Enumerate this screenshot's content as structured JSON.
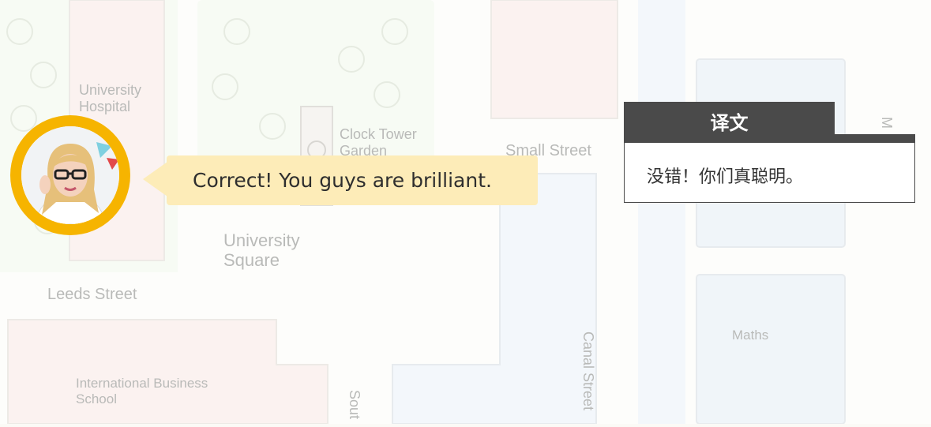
{
  "map": {
    "labels": {
      "hospital_1": "University",
      "hospital_2": "Hospital",
      "clock_tower_1": "Clock Tower",
      "clock_tower_2": "Garden",
      "small_street": "Small Street",
      "university_square_1": "University",
      "university_square_2": "Square",
      "leeds_street": "Leeds Street",
      "canal_street": "Canal Street",
      "maths": "Maths",
      "business_school_1": "International Business",
      "business_school_2": "School",
      "south_partial": "Sout",
      "right_edge_partial": "M"
    }
  },
  "dialog": {
    "speaker_icon": "teacher-avatar",
    "message": "Correct! You guys are brilliant."
  },
  "translation": {
    "title": "译文",
    "text": "没错！你们真聪明。"
  },
  "colors": {
    "avatar_ring": "#f6b400",
    "bubble": "#fdecb8",
    "translation_header": "#4a4a4a"
  }
}
